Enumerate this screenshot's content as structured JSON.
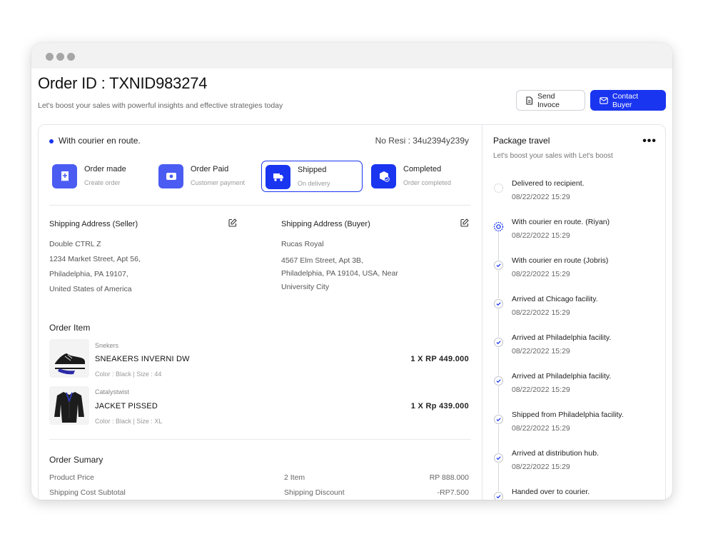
{
  "header": {
    "title": "Order ID : TXNID983274",
    "subtitle": "Let's boost your sales with powerful insights and effective strategies today",
    "send_invoice_label": "Send Invoce",
    "contact_buyer_label": "Contact Buyer"
  },
  "order": {
    "status_text": "With courier en route.",
    "resi": "No Resi : 34u2394y239y"
  },
  "steps": [
    {
      "label": "Order made",
      "sub": "Create order"
    },
    {
      "label": "Order Paid",
      "sub": "Customer payment"
    },
    {
      "label": "Shipped",
      "sub": "On delivery"
    },
    {
      "label": "Completed",
      "sub": "Order completed"
    }
  ],
  "seller_address": {
    "heading": "Shipping Address (Seller)",
    "lines": [
      "Double CTRL  Z",
      "1234 Market Street, Apt 56,",
      "Philadelphia, PA 19107,",
      "United States of America"
    ]
  },
  "buyer_address": {
    "heading": "Shipping Address (Buyer)",
    "lines": [
      "Rucas Royal",
      "4567 Elm Street,  Apt 3B,",
      "Philadelphia, PA 19104, USA, Near",
      "University City"
    ]
  },
  "order_items": {
    "heading": "Order Item",
    "items": [
      {
        "brand": "Snekers",
        "name": "SNEAKERS INVERNI DW",
        "meta": "Color : Black   |   Size : 44",
        "price": "1 X RP 449.000"
      },
      {
        "brand": "Catalystwist",
        "name": "JACKET PISSED",
        "meta": "Color : Black   |   Size : XL",
        "price": "1 X Rp 439.000"
      }
    ]
  },
  "summary": {
    "heading": "Order Sumary",
    "rows": [
      {
        "label": "Product Price",
        "mid": "2 Item",
        "value": "RP 888.000"
      },
      {
        "label": "Shipping Cost Subtotal",
        "mid": "Shipping Discount",
        "value": "-RP7.500"
      }
    ]
  },
  "package": {
    "title": "Package travel",
    "subtitle": "Let's boost your sales with Let's boost",
    "more_label": "•••",
    "events": [
      {
        "text": "Delivered to recipient.",
        "time": "08/22/2022 15:29",
        "state": "pending"
      },
      {
        "text": "With courier en route.  (Riyan)",
        "time": "08/22/2022 15:29",
        "state": "current"
      },
      {
        "text": "With courier en route (Jobris)",
        "time": "08/22/2022 15:29",
        "state": "done"
      },
      {
        "text": "Arrived at Chicago facility.",
        "time": "08/22/2022 15:29",
        "state": "done"
      },
      {
        "text": "Arrived at Philadelphia facility.",
        "time": "08/22/2022 15:29",
        "state": "done"
      },
      {
        "text": "Arrived at Philadelphia facility.",
        "time": "08/22/2022 15:29",
        "state": "done"
      },
      {
        "text": "Shipped from Philadelphia facility.",
        "time": "08/22/2022 15:29",
        "state": "done"
      },
      {
        "text": "Arrived at distribution hub.",
        "time": "08/22/2022 15:29",
        "state": "done"
      },
      {
        "text": "Handed over to courier.",
        "time": "",
        "state": "done"
      }
    ]
  },
  "colors": {
    "primary": "#1a35f0",
    "muted": "#9a9a9a"
  }
}
